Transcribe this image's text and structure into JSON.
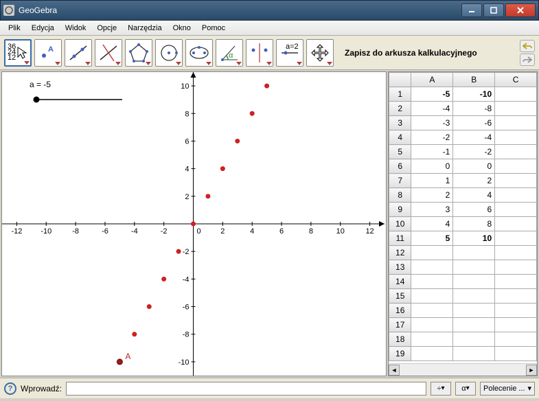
{
  "window": {
    "title": "GeoGebra"
  },
  "menu": {
    "items": [
      "Plik",
      "Edycja",
      "Widok",
      "Opcje",
      "Narzędzia",
      "Okno",
      "Pomoc"
    ]
  },
  "toolbar": {
    "tools": [
      "move",
      "point",
      "line",
      "perpendicular",
      "polygon",
      "circle",
      "ellipse",
      "angle",
      "reflect",
      "slider",
      "move-view"
    ],
    "selected_index": 0,
    "label": "Zapisz do arkusza kalkulacyjnego"
  },
  "graphics": {
    "slider_label": "a = -5",
    "point_label": "A",
    "x_ticks": [
      -12,
      -10,
      -8,
      -6,
      -4,
      -2,
      0,
      2,
      4,
      6,
      8,
      10,
      12
    ],
    "y_ticks": [
      -10,
      -8,
      -6,
      -4,
      -2,
      2,
      4,
      6,
      8,
      10
    ],
    "origin_label": "0"
  },
  "chart_data": {
    "type": "scatter",
    "x": [
      -5,
      -4,
      -3,
      -2,
      -1,
      0,
      1,
      2,
      3,
      4,
      5
    ],
    "y": [
      -10,
      -8,
      -6,
      -4,
      -2,
      0,
      2,
      4,
      6,
      8,
      10
    ],
    "xlim": [
      -13,
      13
    ],
    "ylim": [
      -11,
      11
    ],
    "xlabel": "",
    "ylabel": "",
    "title": "",
    "slider": {
      "name": "a",
      "value": -5,
      "min": -5,
      "max": 5
    },
    "labeled_point": {
      "name": "A",
      "x": -5,
      "y": -10
    }
  },
  "spreadsheet": {
    "columns": [
      "A",
      "B",
      "C"
    ],
    "row_count": 19,
    "data": [
      {
        "A": "-5",
        "B": "-10"
      },
      {
        "A": "-4",
        "B": "-8"
      },
      {
        "A": "-3",
        "B": "-6"
      },
      {
        "A": "-2",
        "B": "-4"
      },
      {
        "A": "-1",
        "B": "-2"
      },
      {
        "A": "0",
        "B": "0"
      },
      {
        "A": "1",
        "B": "2"
      },
      {
        "A": "2",
        "B": "4"
      },
      {
        "A": "3",
        "B": "6"
      },
      {
        "A": "4",
        "B": "8"
      },
      {
        "A": "5",
        "B": "10"
      }
    ],
    "bold_rows": [
      0,
      10
    ]
  },
  "inputbar": {
    "label": "Wprowadź:",
    "value": "",
    "symbol1": "÷",
    "symbol2": "α",
    "command": "Polecenie ..."
  }
}
